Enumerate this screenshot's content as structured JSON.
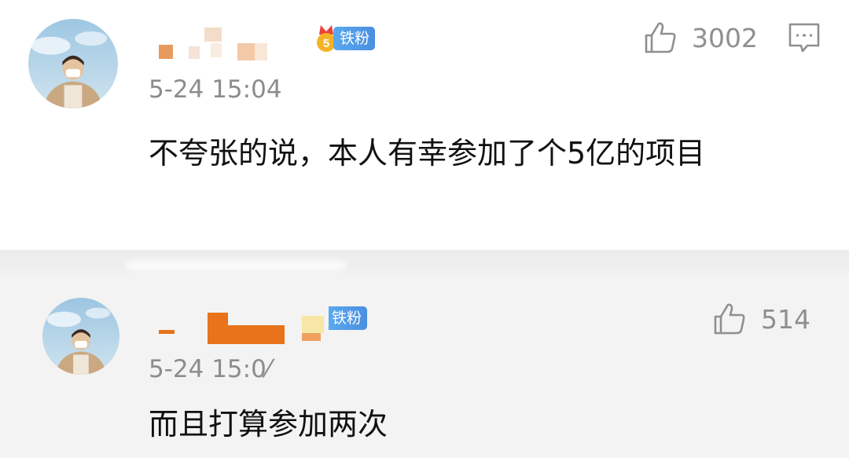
{
  "comments": [
    {
      "badge": "铁粉",
      "badge_level": "5",
      "timestamp": "5-24 15:04",
      "text": "不夸张的说，本人有幸参加了个5亿的项目",
      "likes": "3002",
      "icons": [
        "avatar",
        "thumbs-up-icon",
        "reply-icon",
        "fan-badge-icon"
      ]
    },
    {
      "badge": "铁粉",
      "timestamp": "5-24 15:0⁄",
      "text": "而且打算参加两次",
      "likes": "514",
      "icons": [
        "avatar",
        "thumbs-up-icon"
      ]
    }
  ],
  "colors": {
    "badge_blue": "#4a8fe0",
    "censor_orange": "#e8731a",
    "timestamp_gray": "#8c8c8c",
    "comment2_bg": "#f3f3f3"
  }
}
